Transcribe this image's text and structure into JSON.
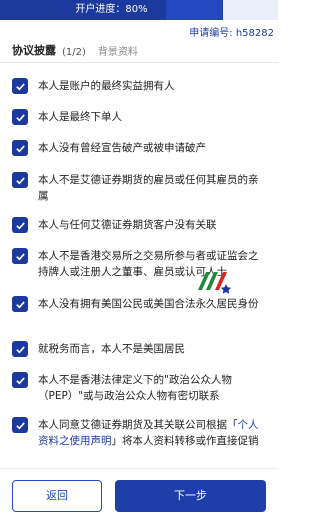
{
  "progress": {
    "label": "开户进度：80%",
    "fraction": 0.8
  },
  "header": {
    "application_number": "申请编号: h58282"
  },
  "tabs": {
    "active": "协议披露",
    "count": "(1/2)",
    "other": "背景资料"
  },
  "disclosures": [
    {
      "text": "本人是账户的最终实益拥有人",
      "checked": true
    },
    {
      "text": "本人是最终下单人",
      "checked": true
    },
    {
      "text": "本人没有曾经宣告破产或被申请破产",
      "checked": true
    },
    {
      "text": "本人不是艾德证券期货的雇员或任何其雇员的亲属",
      "checked": true
    },
    {
      "text": "本人与任何艾德证券期货客户没有关联",
      "checked": true
    },
    {
      "text": "本人不是香港交易所之交易所参与者或证监会之持牌人或注册人之董事、雇员或认可人士",
      "checked": true
    },
    {
      "text": "本人没有拥有美国公民或美国合法永久居民身份",
      "checked": true
    },
    {
      "text": "就税务而言，本人不是美国居民",
      "checked": true
    },
    {
      "text": "本人不是香港法律定义下的\"政治公众人物（PEP）\"或与政治公众人物有密切联系",
      "checked": true
    },
    {
      "text_before": "本人同意艾德证券期货及其关联公司根据「",
      "link": "个人资料之使用声明",
      "text_after": "」将本人资料转移或作直接促销",
      "checked": true
    }
  ],
  "buttons": {
    "back": "返回",
    "next": "下一步"
  },
  "colors": {
    "primary": "#1c3a9e",
    "accent": "#2448c0"
  },
  "icons": {
    "checkbox": "check-icon",
    "watermark": "logo-icon"
  }
}
